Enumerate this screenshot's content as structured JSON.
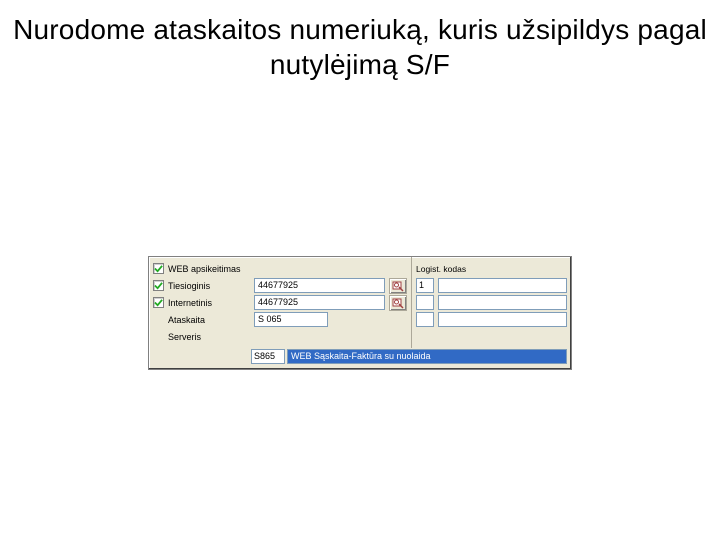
{
  "title": "Nurodome ataskaitos numeriuką, kuris užsipildys pagal nutylėjimą S/F",
  "left": {
    "row1": {
      "label": "WEB apsikeitimas"
    },
    "row2": {
      "label": "Tiesioginis",
      "value": "44677925"
    },
    "row3": {
      "label": "Internetinis",
      "value": "44677925"
    },
    "row4": {
      "label": "Ataskaita",
      "value": "S 065"
    },
    "row5": {
      "label": "Serveris"
    }
  },
  "right": {
    "header": "Logist. kodas",
    "num": "1"
  },
  "dropdown": {
    "code": "S865",
    "text": "WEB Sąskaita-Faktūra su nuolaida"
  }
}
